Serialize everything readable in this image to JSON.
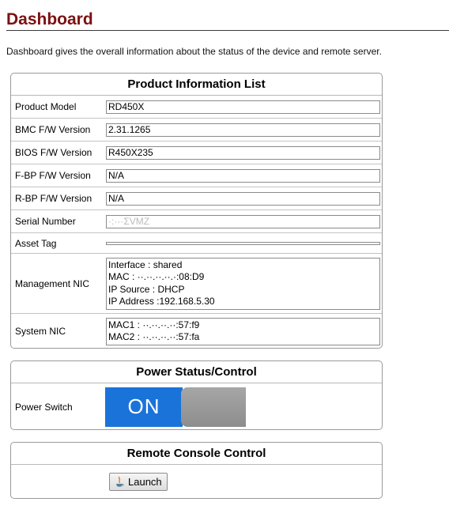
{
  "header": {
    "title": "Dashboard",
    "description": "Dashboard gives the overall information about the status of the device and remote server."
  },
  "product_info": {
    "title": "Product Information List",
    "rows": [
      {
        "label": "Product Model",
        "value": "RD450X"
      },
      {
        "label": "BMC F/W Version",
        "value": "2.31.1265"
      },
      {
        "label": "BIOS F/W Version",
        "value": "R450X235"
      },
      {
        "label": "F-BP F/W Version",
        "value": "N/A"
      },
      {
        "label": "R-BP F/W Version",
        "value": "N/A"
      },
      {
        "label": "Serial Number",
        "value": "·:···ΣVMZ"
      },
      {
        "label": "Asset Tag",
        "value": ""
      }
    ],
    "management_nic": {
      "label": "Management NIC",
      "lines": [
        "Interface : shared",
        "MAC : ··.··.··.··.·:08:D9",
        "IP Source : DHCP",
        "IP Address :192.168.5.30"
      ]
    },
    "system_nic": {
      "label": "System NIC",
      "lines": [
        "MAC1 : ··.··.··.··:57:f9",
        "MAC2 : ··.··.··.··:57:fa"
      ]
    }
  },
  "power": {
    "title": "Power Status/Control",
    "switch_label": "Power Switch",
    "state": "ON"
  },
  "remote_console": {
    "title": "Remote Console Control",
    "launch_label": "Launch",
    "icon": "java-icon"
  },
  "colors": {
    "title": "#7b1111",
    "toggle_on": "#1a73d9",
    "toggle_off": "#999999"
  }
}
